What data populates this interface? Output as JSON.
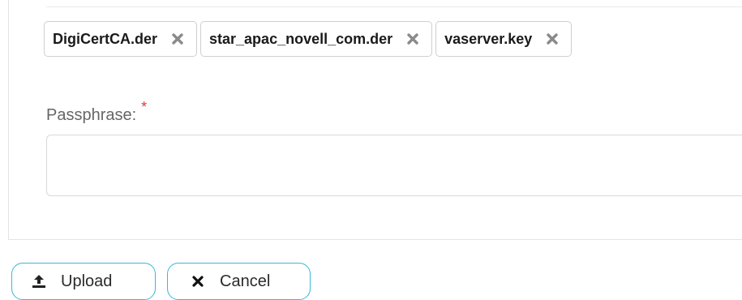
{
  "files": [
    {
      "name": "DigiCertCA.der",
      "remove_icon": "close-x-icon"
    },
    {
      "name": "star_apac_novell_com.der",
      "remove_icon": "close-x-icon"
    },
    {
      "name": "vaserver.key",
      "remove_icon": "close-x-icon"
    }
  ],
  "passphrase": {
    "label": "Passphrase:",
    "required_mark": "*",
    "value": "",
    "placeholder": ""
  },
  "actions": {
    "upload_label": "Upload",
    "upload_icon": "upload-icon",
    "cancel_label": "Cancel",
    "cancel_icon": "close-icon"
  },
  "colors": {
    "accent_border": "#39b8d6",
    "required": "#e03a3a",
    "label_text": "#666666"
  }
}
